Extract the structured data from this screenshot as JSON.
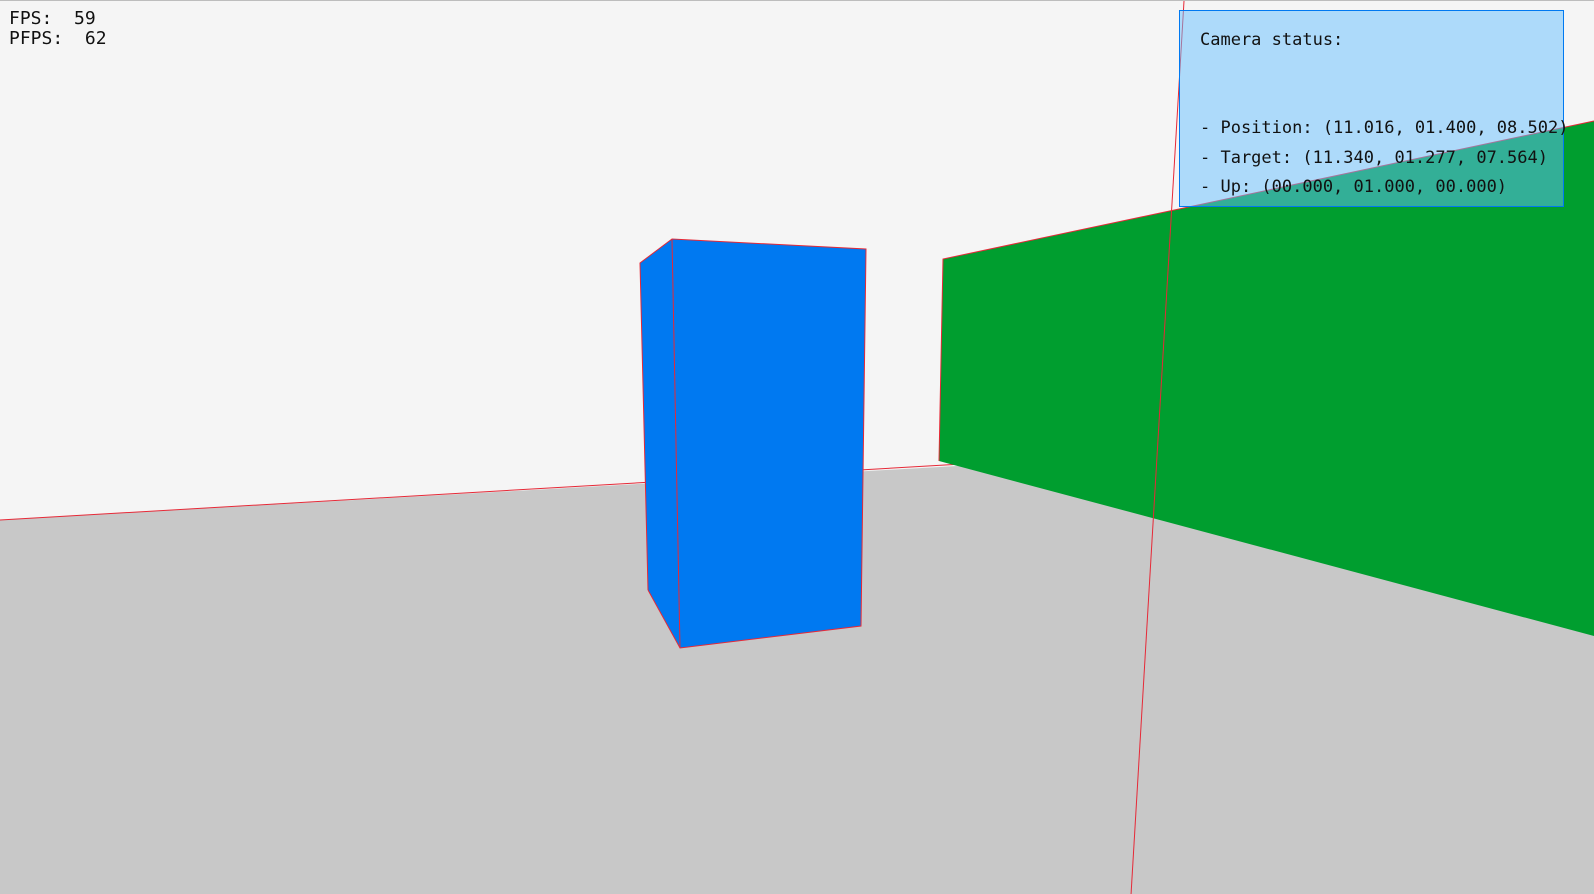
{
  "hud": {
    "fps_label": "FPS:",
    "fps_value": "59",
    "pfps_label": "PFPS:",
    "pfps_value": "62"
  },
  "camera_panel": {
    "title": "Camera status:",
    "position_line": "- Position: (11.016, 01.400, 08.502)",
    "target_line": "- Target: (11.340, 01.277, 07.564)",
    "up_line": "- Up: (00.000, 01.000, 00.000)"
  },
  "scene": {
    "colors": {
      "sky": "#f5f5f5",
      "ground": "#c8c8c8",
      "cube": "#0079f1",
      "wall": "#009e2f",
      "wire": "#e62937",
      "panel_fill": "#66bfff",
      "panel_border": "#0079f1"
    }
  }
}
